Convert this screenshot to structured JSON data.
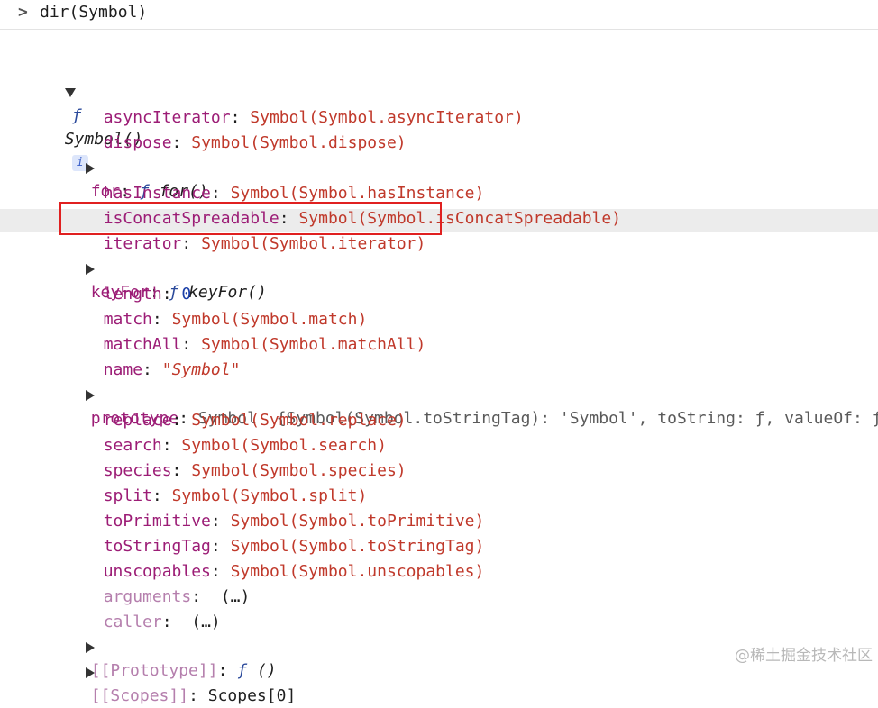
{
  "console": {
    "prompt_caret": ">",
    "command": "dir(Symbol)"
  },
  "root": {
    "f_glyph": "ƒ",
    "name": "Symbol()",
    "info_badge": "i"
  },
  "props": [
    {
      "key": "asyncIterator",
      "value": "Symbol(Symbol.asyncIterator)"
    },
    {
      "key": "dispose",
      "value": "Symbol(Symbol.dispose)"
    },
    {
      "key": "for",
      "f_glyph": "ƒ",
      "value": "for()"
    },
    {
      "key": "hasInstance",
      "value": "Symbol(Symbol.hasInstance)"
    },
    {
      "key": "isConcatSpreadable",
      "value": "Symbol(Symbol.isConcatSpreadable)"
    },
    {
      "key": "iterator",
      "value": "Symbol(Symbol.iterator)"
    },
    {
      "key": "keyFor",
      "f_glyph": "ƒ",
      "value": "keyFor()"
    },
    {
      "key": "length",
      "value": "0"
    },
    {
      "key": "match",
      "value": "Symbol(Symbol.match)"
    },
    {
      "key": "matchAll",
      "value": "Symbol(Symbol.matchAll)"
    },
    {
      "key": "name",
      "value": "\"Symbol\""
    },
    {
      "key": "prototype",
      "value": "Symbol",
      "preview": "{Symbol(Symbol.toStringTag): 'Symbol', toString: ƒ, valueOf: ƒ, S"
    },
    {
      "key": "replace",
      "value": "Symbol(Symbol.replace)"
    },
    {
      "key": "search",
      "value": "Symbol(Symbol.search)"
    },
    {
      "key": "species",
      "value": "Symbol(Symbol.species)"
    },
    {
      "key": "split",
      "value": "Symbol(Symbol.split)"
    },
    {
      "key": "toPrimitive",
      "value": "Symbol(Symbol.toPrimitive)"
    },
    {
      "key": "toStringTag",
      "value": "Symbol(Symbol.toStringTag)"
    },
    {
      "key": "unscopables",
      "value": "Symbol(Symbol.unscopables)"
    },
    {
      "key": "arguments",
      "value": "(…)"
    },
    {
      "key": "caller",
      "value": "(…)"
    },
    {
      "key": "[[Prototype]]",
      "f_glyph": "ƒ",
      "value": "()"
    },
    {
      "key": "[[Scopes]]",
      "value": "Scopes[0]"
    }
  ],
  "colon": ":",
  "watermark": "@稀土掘金技术社区",
  "colors": {
    "key": "#9c1d76",
    "symbol_value": "#c0392b",
    "number": "#1a3fa8",
    "highlight_box": "#e02020"
  }
}
